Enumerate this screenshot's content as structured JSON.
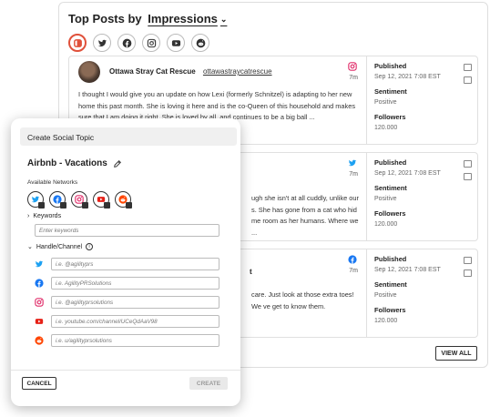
{
  "panel": {
    "title_prefix": "Top Posts by",
    "metric": "Impressions",
    "networks": [
      "all-networks-icon",
      "twitter-icon",
      "facebook-icon",
      "instagram-icon",
      "youtube-icon",
      "reddit-icon"
    ]
  },
  "posts": [
    {
      "account_name": "Ottawa Stray Cat Rescue",
      "handle": "ottawastraycatrescue",
      "network": "instagram",
      "age": "7m",
      "text": "I thought I would give you an update on how Lexi (formerly Schnitzel) is adapting to her new home this past month. She is loving it here and is the co-Queen of this household and makes sure that I am doing it right. She is loved by all, and continues to be a big ball ...",
      "published_label": "Published",
      "published": "Sep 12, 2021 7:08 EST",
      "sentiment_label": "Sentiment",
      "sentiment": "Positive",
      "followers_label": "Followers",
      "followers": "120.000"
    },
    {
      "account_name": "",
      "handle": "",
      "network": "twitter",
      "age": "7m",
      "text": "ugh she isn't at all cuddly, unlike our s. She has gone from a cat who hid me room as her humans. Where we ...",
      "published_label": "Published",
      "published": "Sep 12, 2021 7:08 EST",
      "sentiment_label": "Sentiment",
      "sentiment": "Positive",
      "followers_label": "Followers",
      "followers": "120.000"
    },
    {
      "account_name": "t",
      "handle": "",
      "network": "facebook",
      "age": "7m",
      "text": "care. Just look at those extra toes! We ve get to know them.",
      "published_label": "Published",
      "published": "Sep 12, 2021 7:08 EST",
      "sentiment_label": "Sentiment",
      "sentiment": "Positive",
      "followers_label": "Followers",
      "followers": "120.000"
    }
  ],
  "view_all": "VIEW ALL",
  "modal": {
    "header": "Create Social Topic",
    "topic_name": "Airbnb - Vacations",
    "available_networks_label": "Available Networks",
    "available_networks": [
      "twitter-icon",
      "facebook-icon",
      "instagram-icon",
      "youtube-icon",
      "reddit-icon"
    ],
    "keywords_label": "Keywords",
    "keywords_placeholder": "Enter keywords",
    "handle_label": "Handle/Channel",
    "handles": [
      {
        "network": "twitter",
        "placeholder": "i.e. @agilityprs"
      },
      {
        "network": "facebook",
        "placeholder": "i.e. AgilityPRSolutions"
      },
      {
        "network": "instagram",
        "placeholder": "i.e. @agilityprsolutions"
      },
      {
        "network": "youtube",
        "placeholder": "i.e. youtube.com/channel/UCeQdAaV98"
      },
      {
        "network": "reddit",
        "placeholder": "i.e. u/agilityprsolutions"
      }
    ],
    "cancel": "CANCEL",
    "create": "CREATE"
  },
  "colors": {
    "twitter": "#1da1f2",
    "facebook": "#1877f2",
    "instagram": "#e1306c",
    "youtube": "#e62117",
    "reddit": "#ff4500",
    "active_ring": "#e0513b"
  }
}
